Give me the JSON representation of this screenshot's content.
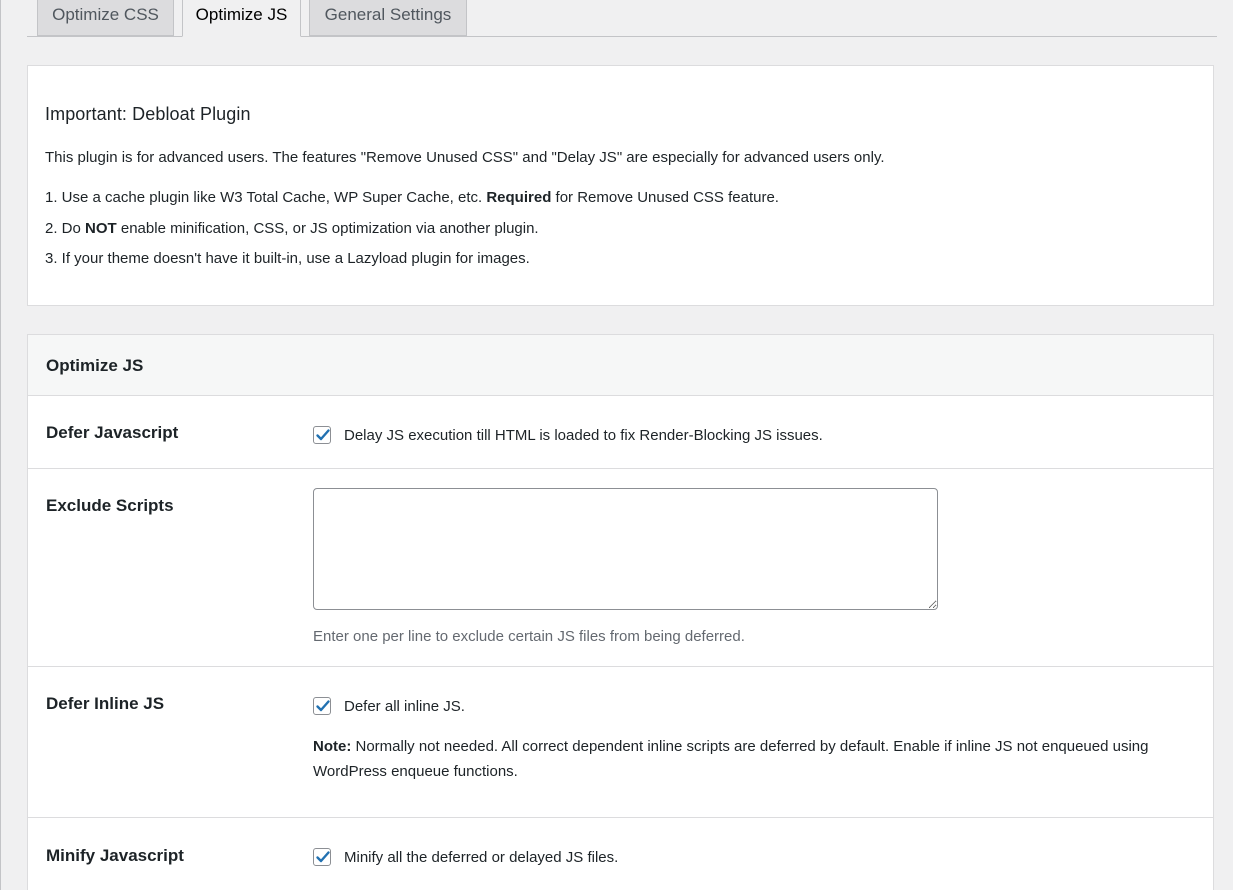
{
  "tabs": [
    {
      "label": "Optimize CSS",
      "active": false
    },
    {
      "label": "Optimize JS",
      "active": true
    },
    {
      "label": "General Settings",
      "active": false
    }
  ],
  "notice": {
    "title": "Important: Debloat Plugin",
    "intro": "This plugin is for advanced users. The features \"Remove Unused CSS\" and \"Delay JS\" are especially for advanced users only.",
    "items": [
      {
        "prefix": "1. Use a cache plugin like W3 Total Cache, WP Super Cache, etc. ",
        "bold": "Required",
        "suffix": " for Remove Unused CSS feature."
      },
      {
        "prefix": "2. Do ",
        "bold": "NOT",
        "suffix": " enable minification, CSS, or JS optimization via another plugin."
      },
      {
        "prefix": "3. If your theme doesn't have it built-in, use a Lazyload plugin for images.",
        "bold": "",
        "suffix": ""
      }
    ]
  },
  "settings": {
    "title": "Optimize JS",
    "defer_js": {
      "label": "Defer Javascript",
      "checked": true,
      "text": "Delay JS execution till HTML is loaded to fix Render-Blocking JS issues."
    },
    "exclude_scripts": {
      "label": "Exclude Scripts",
      "value": "",
      "description": "Enter one per line to exclude certain JS files from being deferred."
    },
    "defer_inline": {
      "label": "Defer Inline JS",
      "checked": true,
      "text": "Defer all inline JS.",
      "note_label": "Note:",
      "note_text": " Normally not needed. All correct dependent inline scripts are deferred by default. Enable if inline JS not enqueued using WordPress enqueue functions."
    },
    "minify_js": {
      "label": "Minify Javascript",
      "checked": true,
      "text": "Minify all the deferred or delayed JS files."
    }
  },
  "colors": {
    "checkmark": "#2271b1",
    "background": "#f0f0f1",
    "card": "#ffffff"
  },
  "icons": {
    "checkbox_checked": "checkmark-icon"
  }
}
